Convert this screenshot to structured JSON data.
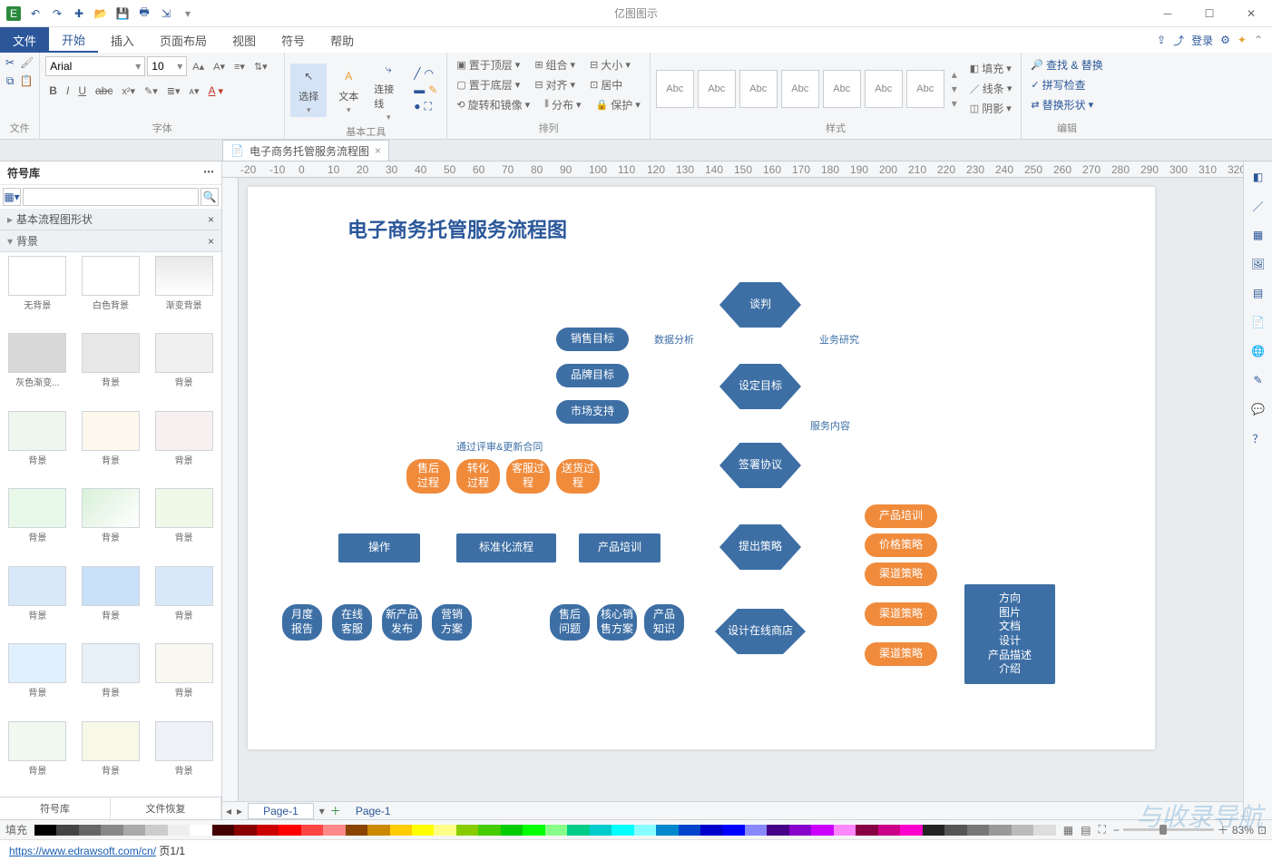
{
  "app_title": "亿图图示",
  "tabs": {
    "file": "文件",
    "home": "开始",
    "insert": "插入",
    "layout": "页面布局",
    "view": "视图",
    "symbol": "符号",
    "help": "帮助"
  },
  "ribbon_right": {
    "login": "登录"
  },
  "groups": {
    "file": "文件",
    "font": "字体",
    "basic": "基本工具",
    "arrange": "排列",
    "style": "样式",
    "edit": "编辑"
  },
  "font": {
    "name": "Arial",
    "size": "10"
  },
  "tools": {
    "select": "选择",
    "text": "文本",
    "connector": "连接线"
  },
  "arrange": {
    "top": "置于顶层",
    "bottom": "置于底层",
    "rotate": "旋转和镜像",
    "group": "组合",
    "align": "对齐",
    "distribute": "分布",
    "size": "大小",
    "center": "居中",
    "protect": "保护"
  },
  "style_label": "Abc",
  "style_cmds": {
    "fill": "填充",
    "line": "线条",
    "shadow": "阴影"
  },
  "edit_cmds": {
    "find": "查找 & 替换",
    "spell": "拼写检查",
    "replace_shape": "替换形状"
  },
  "doc_tab": "电子商务托管服务流程图",
  "sidebar": {
    "title": "符号库",
    "cats": [
      "基本流程图形状",
      "背景"
    ],
    "items": [
      "无背景",
      "白色背景",
      "渐变背景",
      "灰色渐变...",
      "背景",
      "背景",
      "背景",
      "背景",
      "背景",
      "背景",
      "背景",
      "背景",
      "背景",
      "背景",
      "背景",
      "背景",
      "背景",
      "背景",
      "背景",
      "背景",
      "背景"
    ],
    "bottom": [
      "符号库",
      "文件恢复"
    ]
  },
  "diagram": {
    "title": "电子商务托管服务流程图",
    "nodes": {
      "n1": "谈判",
      "n2": "设定目标",
      "n3": "签署协议",
      "n4": "提出策略",
      "n5": "设计在线商店",
      "g1": "销售目标",
      "g2": "品牌目标",
      "g3": "市场支持",
      "p1": "售后\n过程",
      "p2": "转化\n过程",
      "p3": "客服过\n程",
      "p4": "送货过\n程",
      "r1": "操作",
      "r2": "标准化流程",
      "r3": "产品培训",
      "b1": "月度\n报告",
      "b2": "在线\n客服",
      "b3": "新产品\n发布",
      "b4": "营销\n方案",
      "c1": "售后\n问题",
      "c2": "核心销\n售方案",
      "c3": "产品\n知识",
      "s1": "产品培训",
      "s2": "价格策略",
      "s3": "渠道策略",
      "s4": "渠道策略",
      "s5": "渠道策略",
      "big": [
        "方向",
        "图片",
        "文档",
        "设计",
        "产品描述",
        "介绍"
      ]
    },
    "labels": {
      "e1": "数据分析",
      "e2": "业务研究",
      "e3": "服务内容",
      "e4": "通过评审&更新合同"
    }
  },
  "pagebar": {
    "sheet": "Page-1",
    "sheet2": "Page-1"
  },
  "status": {
    "fill": "填充",
    "zoom": "83%"
  },
  "footer": {
    "url": "https://www.edrawsoft.com/cn/",
    "page": "页1/1"
  },
  "watermark": "与收录导航"
}
